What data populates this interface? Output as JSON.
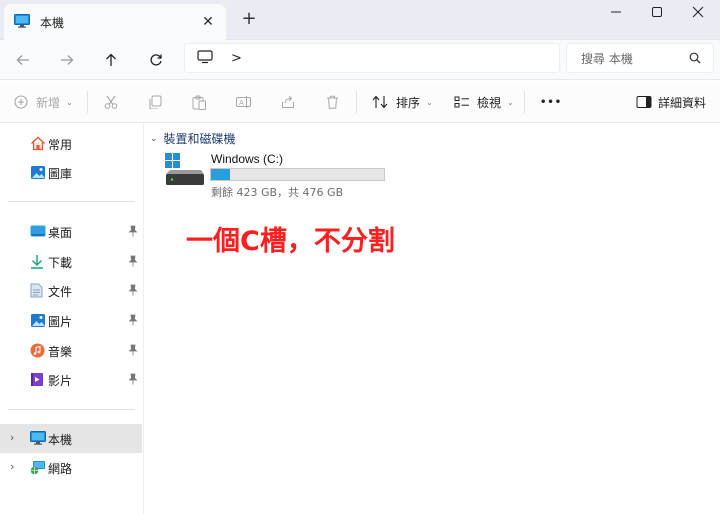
{
  "tab": {
    "title": "本機"
  },
  "address": {
    "separator": ">"
  },
  "search": {
    "placeholder": "搜尋 本機"
  },
  "commands": {
    "new_label": "新增",
    "sort_label": "排序",
    "view_label": "檢視",
    "more_label": "•••",
    "details_label": "詳細資料"
  },
  "sidebar": {
    "home": "常用",
    "gallery": "圖庫",
    "desktop": "桌面",
    "downloads": "下載",
    "documents": "文件",
    "pictures": "圖片",
    "music": "音樂",
    "videos": "影片",
    "this_pc": "本機",
    "network": "網路"
  },
  "main": {
    "group_label": "裝置和磁碟機",
    "drive": {
      "name": "Windows (C:)",
      "free_text": "剩餘 423 GB，共 476 GB",
      "used_fraction": 0.111
    }
  },
  "annotation": {
    "text": "一個C槽，不分割"
  },
  "colors": {
    "accent": "#26a0da",
    "annotation": "#ff1f1f"
  }
}
